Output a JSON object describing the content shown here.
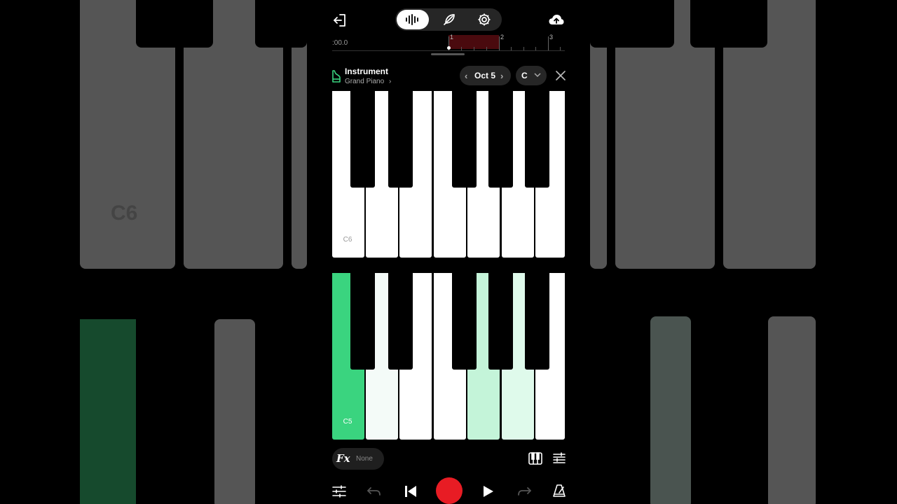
{
  "background": {
    "labels": {
      "c6": "C6"
    }
  },
  "toolbar": {
    "exit_icon": "exit-icon",
    "modes": [
      {
        "name": "waveform-icon",
        "active": true
      },
      {
        "name": "quill-icon",
        "active": false
      },
      {
        "name": "gear-icon",
        "active": false
      }
    ],
    "upload_icon": "cloud-upload-icon"
  },
  "timeline": {
    "time": ":00.0",
    "bars": [
      "1",
      "2",
      "3"
    ],
    "region_color": "#4a0a0e"
  },
  "instrument": {
    "title": "Instrument",
    "name": "Grand Piano",
    "octave": "Oct 5",
    "key": "C"
  },
  "keyboard": {
    "upper_label": "C6",
    "lower_label": "C5",
    "highlight_color": "#3ad47f"
  },
  "fx": {
    "icon": "Fx",
    "value": "None"
  },
  "transport": {
    "record_color": "#e81c24",
    "icons": [
      "mixer-sliders-icon",
      "undo-icon",
      "skip-back-icon",
      "record-button",
      "play-icon",
      "redo-icon",
      "metronome-icon"
    ]
  }
}
